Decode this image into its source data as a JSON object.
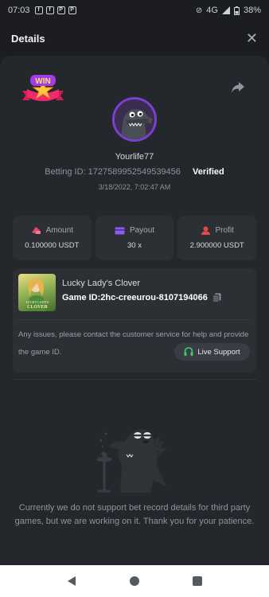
{
  "status_bar": {
    "time": "07:03",
    "network": "4G",
    "battery": "38%"
  },
  "header": {
    "title": "Details",
    "close_icon": "close-icon"
  },
  "badge": {
    "text": "WIN"
  },
  "user": {
    "name": "Yourlife77",
    "betting_id_label": "Betting ID:",
    "betting_id": "1727589952549539456",
    "verified": "Verified",
    "datetime": "3/18/2022, 7:02:47 AM"
  },
  "stats": [
    {
      "label": "Amount",
      "value": "0.100000 USDT",
      "icon": "amount-icon",
      "color": "#e04a6a"
    },
    {
      "label": "Payout",
      "value": "30 x",
      "icon": "payout-icon",
      "color": "#8d5cf0"
    },
    {
      "label": "Profit",
      "value": "2.900000 USDT",
      "icon": "profit-icon",
      "color": "#e04a4a"
    }
  ],
  "game": {
    "name": "Lucky Lady's Clover",
    "id_label": "Game ID:",
    "id": "2hc-creeurou-8107194066",
    "thumb_line1": "LUCKY LADY'S",
    "thumb_line2": "CLOVER"
  },
  "support": {
    "message": "Any issues, please contact the customer service for help and provide the game ID.",
    "button": "Live Support"
  },
  "empty_state": {
    "message": "Currently we do not support bet record details for third party games, but we are working on it. Thank you for your patience."
  },
  "colors": {
    "accent_green": "#3fcf6a",
    "verified": "#ffffff",
    "background": "#24272b"
  }
}
